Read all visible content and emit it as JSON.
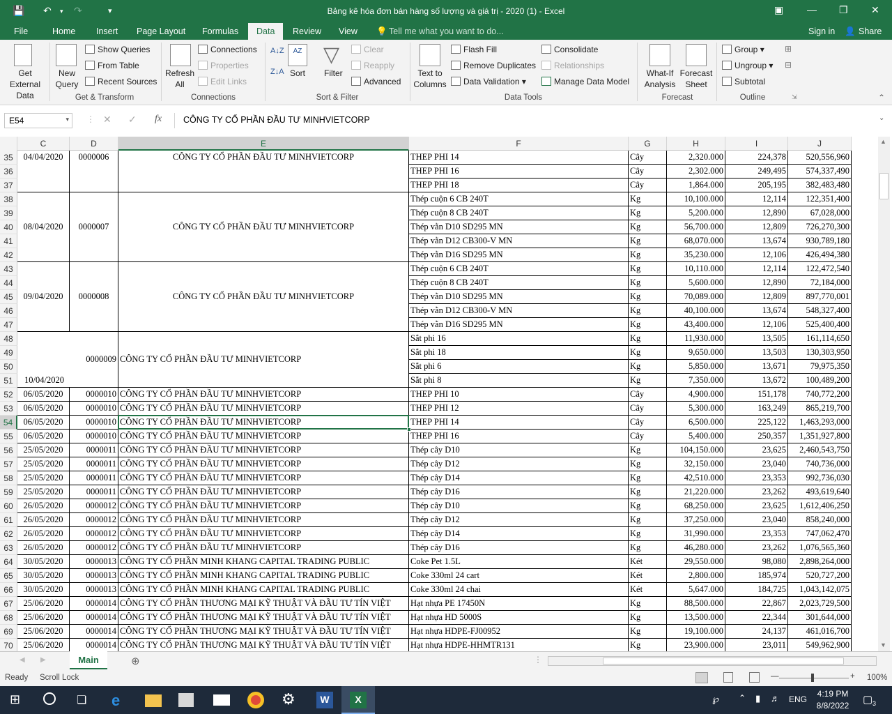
{
  "window": {
    "title": "Bảng kê hóa đơn bán hàng số lượng và giá trị - 2020 (1) - Excel"
  },
  "tabs": [
    "File",
    "Home",
    "Insert",
    "Page Layout",
    "Formulas",
    "Data",
    "Review",
    "View"
  ],
  "tell_me": "Tell me what you want to do...",
  "signin": "Sign in",
  "share": "Share",
  "ribbon": {
    "get_external": "Get External Data",
    "new_query": "New Query",
    "show_queries": "Show Queries",
    "from_table": "From Table",
    "recent_sources": "Recent Sources",
    "grp_transform": "Get & Transform",
    "refresh": "Refresh All",
    "connections": "Connections",
    "properties": "Properties",
    "edit_links": "Edit Links",
    "grp_connections": "Connections",
    "sort": "Sort",
    "filter": "Filter",
    "clear": "Clear",
    "reapply": "Reapply",
    "advanced": "Advanced",
    "grp_sort": "Sort & Filter",
    "text_to_columns": "Text to Columns",
    "flash_fill": "Flash Fill",
    "remove_dup": "Remove Duplicates",
    "data_validation": "Data Validation",
    "consolidate": "Consolidate",
    "relationships": "Relationships",
    "manage_model": "Manage Data Model",
    "grp_tools": "Data Tools",
    "whatif": "What-If Analysis",
    "forecast_sheet": "Forecast Sheet",
    "grp_forecast": "Forecast",
    "group": "Group",
    "ungroup": "Ungroup",
    "subtotal": "Subtotal",
    "grp_outline": "Outline"
  },
  "formula": {
    "namebox": "E54",
    "content": "CÔNG TY CỔ PHẦN ĐẦU TƯ MINHVIETCORP"
  },
  "columns": [
    "C",
    "D",
    "E",
    "F",
    "G",
    "H",
    "I",
    "J"
  ],
  "rows": [
    {
      "n": "35",
      "f": "THEP PHI 14",
      "g": "Cây",
      "h": "2,320.000",
      "i": "224,378",
      "j": "520,556,960"
    },
    {
      "n": "36",
      "f": "THEP PHI 16",
      "g": "Cây",
      "h": "2,302.000",
      "i": "249,495",
      "j": "574,337,490"
    },
    {
      "n": "37",
      "f": "THEP PHI 18",
      "g": "Cây",
      "h": "1,864.000",
      "i": "205,195",
      "j": "382,483,480"
    },
    {
      "n": "38",
      "f": "Thép cuộn 6 CB 240T",
      "g": "Kg",
      "h": "10,100.000",
      "i": "12,114",
      "j": "122,351,400"
    },
    {
      "n": "39",
      "f": "Thép cuộn 8 CB 240T",
      "g": "Kg",
      "h": "5,200.000",
      "i": "12,890",
      "j": "67,028,000"
    },
    {
      "n": "40",
      "f": "Thép vằn D10 SD295 MN",
      "g": "Kg",
      "h": "56,700.000",
      "i": "12,809",
      "j": "726,270,300"
    },
    {
      "n": "41",
      "f": "Thép vằn D12 CB300-V MN",
      "g": "Kg",
      "h": "68,070.000",
      "i": "13,674",
      "j": "930,789,180"
    },
    {
      "n": "42",
      "f": "Thép vằn D16 SD295 MN",
      "g": "Kg",
      "h": "35,230.000",
      "i": "12,106",
      "j": "426,494,380"
    },
    {
      "n": "43",
      "f": "Thép cuộn 6 CB 240T",
      "g": "Kg",
      "h": "10,110.000",
      "i": "12,114",
      "j": "122,472,540"
    },
    {
      "n": "44",
      "f": "Thép cuộn 8 CB 240T",
      "g": "Kg",
      "h": "5,600.000",
      "i": "12,890",
      "j": "72,184,000"
    },
    {
      "n": "45",
      "f": "Thép vằn D10 SD295 MN",
      "g": "Kg",
      "h": "70,089.000",
      "i": "12,809",
      "j": "897,770,001"
    },
    {
      "n": "46",
      "f": "Thép vằn D12 CB300-V MN",
      "g": "Kg",
      "h": "40,100.000",
      "i": "13,674",
      "j": "548,327,400"
    },
    {
      "n": "47",
      "f": "Thép vằn D16 SD295 MN",
      "g": "Kg",
      "h": "43,400.000",
      "i": "12,106",
      "j": "525,400,400"
    },
    {
      "n": "48",
      "f": "Sắt phi 16",
      "g": "Kg",
      "h": "11,930.000",
      "i": "13,505",
      "j": "161,114,650"
    },
    {
      "n": "49",
      "f": "Sắt phi 18",
      "g": "Kg",
      "h": "9,650.000",
      "i": "13,503",
      "j": "130,303,950"
    },
    {
      "n": "50",
      "f": "Sắt phi 6",
      "g": "Kg",
      "h": "5,850.000",
      "i": "13,671",
      "j": "79,975,350"
    },
    {
      "n": "51",
      "f": "Sắt phi 8",
      "g": "Kg",
      "h": "7,350.000",
      "i": "13,672",
      "j": "100,489,200"
    },
    {
      "n": "52",
      "c": "06/05/2020",
      "d": "0000010",
      "e": "CÔNG TY CỔ PHẦN ĐẦU TƯ MINHVIETCORP",
      "f": "THEP PHI 10",
      "g": "Cây",
      "h": "4,900.000",
      "i": "151,178",
      "j": "740,772,200"
    },
    {
      "n": "53",
      "c": "06/05/2020",
      "d": "0000010",
      "e": "CÔNG TY CỔ PHẦN ĐẦU TƯ MINHVIETCORP",
      "f": "THEP PHI 12",
      "g": "Cây",
      "h": "5,300.000",
      "i": "163,249",
      "j": "865,219,700"
    },
    {
      "n": "54",
      "c": "06/05/2020",
      "d": "0000010",
      "e": "CÔNG TY CỔ PHẦN ĐẦU TƯ MINHVIETCORP",
      "f": "THEP PHI 14",
      "g": "Cây",
      "h": "6,500.000",
      "i": "225,122",
      "j": "1,463,293,000"
    },
    {
      "n": "55",
      "c": "06/05/2020",
      "d": "0000010",
      "e": "CÔNG TY CỔ PHẦN ĐẦU TƯ MINHVIETCORP",
      "f": "THEP PHI 16",
      "g": "Cây",
      "h": "5,400.000",
      "i": "250,357",
      "j": "1,351,927,800"
    },
    {
      "n": "56",
      "c": "25/05/2020",
      "d": "0000011",
      "e": "CÔNG TY CỔ PHẦN ĐẦU TƯ MINHVIETCORP",
      "f": "Thép cây D10",
      "g": "Kg",
      "h": "104,150.000",
      "i": "23,625",
      "j": "2,460,543,750"
    },
    {
      "n": "57",
      "c": "25/05/2020",
      "d": "0000011",
      "e": "CÔNG TY CỔ PHẦN ĐẦU TƯ MINHVIETCORP",
      "f": "Thép cây D12",
      "g": "Kg",
      "h": "32,150.000",
      "i": "23,040",
      "j": "740,736,000"
    },
    {
      "n": "58",
      "c": "25/05/2020",
      "d": "0000011",
      "e": "CÔNG TY CỔ PHẦN ĐẦU TƯ MINHVIETCORP",
      "f": "Thép cây D14",
      "g": "Kg",
      "h": "42,510.000",
      "i": "23,353",
      "j": "992,736,030"
    },
    {
      "n": "59",
      "c": "25/05/2020",
      "d": "0000011",
      "e": "CÔNG TY CỔ PHẦN ĐẦU TƯ MINHVIETCORP",
      "f": "Thép cây D16",
      "g": "Kg",
      "h": "21,220.000",
      "i": "23,262",
      "j": "493,619,640"
    },
    {
      "n": "60",
      "c": "26/05/2020",
      "d": "0000012",
      "e": "CÔNG TY CỔ PHẦN ĐẦU TƯ MINHVIETCORP",
      "f": "Thép cây D10",
      "g": "Kg",
      "h": "68,250.000",
      "i": "23,625",
      "j": "1,612,406,250"
    },
    {
      "n": "61",
      "c": "26/05/2020",
      "d": "0000012",
      "e": "CÔNG TY CỔ PHẦN ĐẦU TƯ MINHVIETCORP",
      "f": "Thép cây D12",
      "g": "Kg",
      "h": "37,250.000",
      "i": "23,040",
      "j": "858,240,000"
    },
    {
      "n": "62",
      "c": "26/05/2020",
      "d": "0000012",
      "e": "CÔNG TY CỔ PHẦN ĐẦU TƯ MINHVIETCORP",
      "f": "Thép cây D14",
      "g": "Kg",
      "h": "31,990.000",
      "i": "23,353",
      "j": "747,062,470"
    },
    {
      "n": "63",
      "c": "26/05/2020",
      "d": "0000012",
      "e": "CÔNG TY CỔ PHẦN ĐẦU TƯ MINHVIETCORP",
      "f": "Thép cây D16",
      "g": "Kg",
      "h": "46,280.000",
      "i": "23,262",
      "j": "1,076,565,360"
    },
    {
      "n": "64",
      "c": "30/05/2020",
      "d": "0000013",
      "e": "CÔNG TY CỔ PHẦN MINH KHANG CAPITAL TRADING PUBLIC",
      "f": "Coke Pet 1.5L",
      "g": "Két",
      "h": "29,550.000",
      "i": "98,080",
      "j": "2,898,264,000"
    },
    {
      "n": "65",
      "c": "30/05/2020",
      "d": "0000013",
      "e": "CÔNG TY CỔ PHẦN MINH KHANG CAPITAL TRADING PUBLIC",
      "f": "Coke 330ml 24 cart",
      "g": "Két",
      "h": "2,800.000",
      "i": "185,974",
      "j": "520,727,200"
    },
    {
      "n": "66",
      "c": "30/05/2020",
      "d": "0000013",
      "e": "CÔNG TY CỔ PHẦN MINH KHANG CAPITAL TRADING PUBLIC",
      "f": "Coke 330ml 24 chai",
      "g": "Két",
      "h": "5,647.000",
      "i": "184,725",
      "j": "1,043,142,075"
    },
    {
      "n": "67",
      "c": "25/06/2020",
      "d": "0000014",
      "e": "CÔNG TY CỔ PHẦN THƯƠNG MẠI KỸ THUẬT VÀ ĐẦU TƯ TÍN VIỆT",
      "f": "Hạt nhựa PE 17450N",
      "g": "Kg",
      "h": "88,500.000",
      "i": "22,867",
      "j": "2,023,729,500"
    },
    {
      "n": "68",
      "c": "25/06/2020",
      "d": "0000014",
      "e": "CÔNG TY CỔ PHẦN THƯƠNG MẠI KỸ THUẬT VÀ ĐẦU TƯ TÍN VIỆT",
      "f": "Hạt nhựa HD 5000S",
      "g": "Kg",
      "h": "13,500.000",
      "i": "22,344",
      "j": "301,644,000"
    },
    {
      "n": "69",
      "c": "25/06/2020",
      "d": "0000014",
      "e": "CÔNG TY CỔ PHẦN THƯƠNG MẠI KỸ THUẬT VÀ ĐẦU TƯ TÍN VIỆT",
      "f": "Hạt nhựa HDPE-FJ00952",
      "g": "Kg",
      "h": "19,100.000",
      "i": "24,137",
      "j": "461,016,700"
    },
    {
      "n": "70",
      "c": "25/06/2020",
      "d": "0000014",
      "e": "CÔNG TY CỔ PHẦN THƯƠNG MẠI KỸ THUẬT VÀ ĐẦU TƯ TÍN VIỆT",
      "f": "Hạt nhựa HDPE-HHMTR131",
      "g": "Kg",
      "h": "23,900.000",
      "i": "23,011",
      "j": "549,962,900"
    }
  ],
  "merged": [
    {
      "c": "04/04/2020",
      "d": "0000006",
      "e": "CÔNG TY CỔ PHẦN ĐẦU TƯ MINHVIETCORP"
    },
    {
      "c": "08/04/2020",
      "d": "0000007",
      "e": "CÔNG TY CỔ PHẦN ĐẦU TƯ MINHVIETCORP"
    },
    {
      "c": "09/04/2020",
      "d": "0000008",
      "e": "CÔNG TY CỔ PHẦN ĐẦU TƯ MINHVIETCORP"
    },
    {
      "c": "10/04/2020",
      "d": "0000009",
      "e": "CÔNG TY CỔ PHẦN ĐẦU TƯ MINHVIETCORP"
    }
  ],
  "sheet_tab": "Main",
  "status": {
    "ready": "Ready",
    "scroll_lock": "Scroll Lock",
    "zoom": "100%"
  },
  "taskbar": {
    "time": "4:19 PM",
    "date": "8/8/2022",
    "lang": "ENG",
    "notif": "3"
  }
}
